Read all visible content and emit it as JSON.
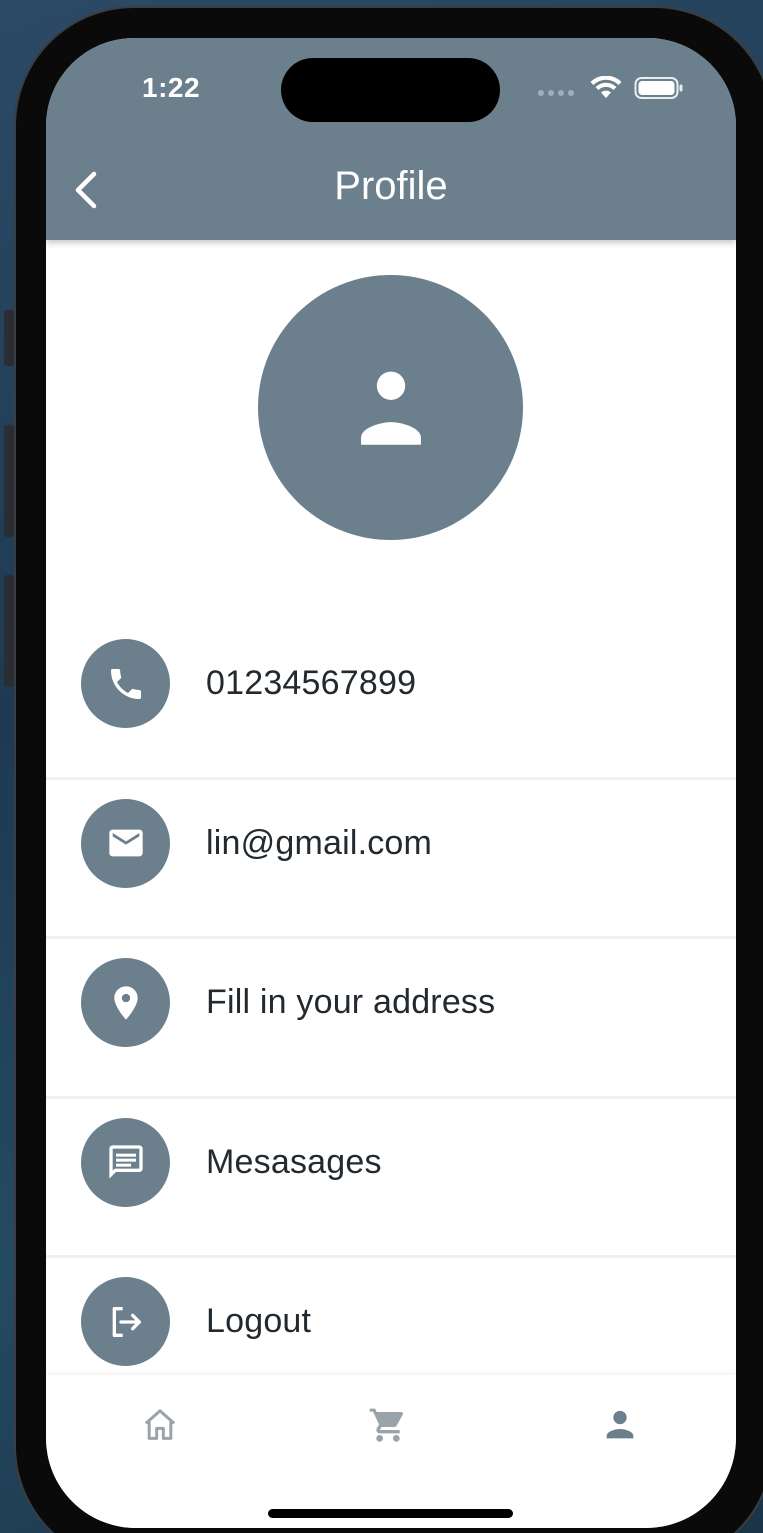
{
  "status_bar": {
    "time": "1:22"
  },
  "appbar": {
    "title": "Profile"
  },
  "profile": {
    "items": [
      {
        "icon": "phone-icon",
        "label": "01234567899"
      },
      {
        "icon": "mail-icon",
        "label": "lin@gmail.com"
      },
      {
        "icon": "location-icon",
        "label": "Fill in your address"
      },
      {
        "icon": "message-icon",
        "label": "Mesasages"
      },
      {
        "icon": "logout-icon",
        "label": "Logout"
      }
    ]
  },
  "bottom_nav": {
    "items": [
      {
        "icon": "home-icon",
        "active": false
      },
      {
        "icon": "cart-icon",
        "active": false
      },
      {
        "icon": "person-icon",
        "active": true
      }
    ]
  },
  "colors": {
    "primary": "#6b7f8c",
    "text": "#222a30",
    "inactive_nav": "#9aa3a9"
  }
}
